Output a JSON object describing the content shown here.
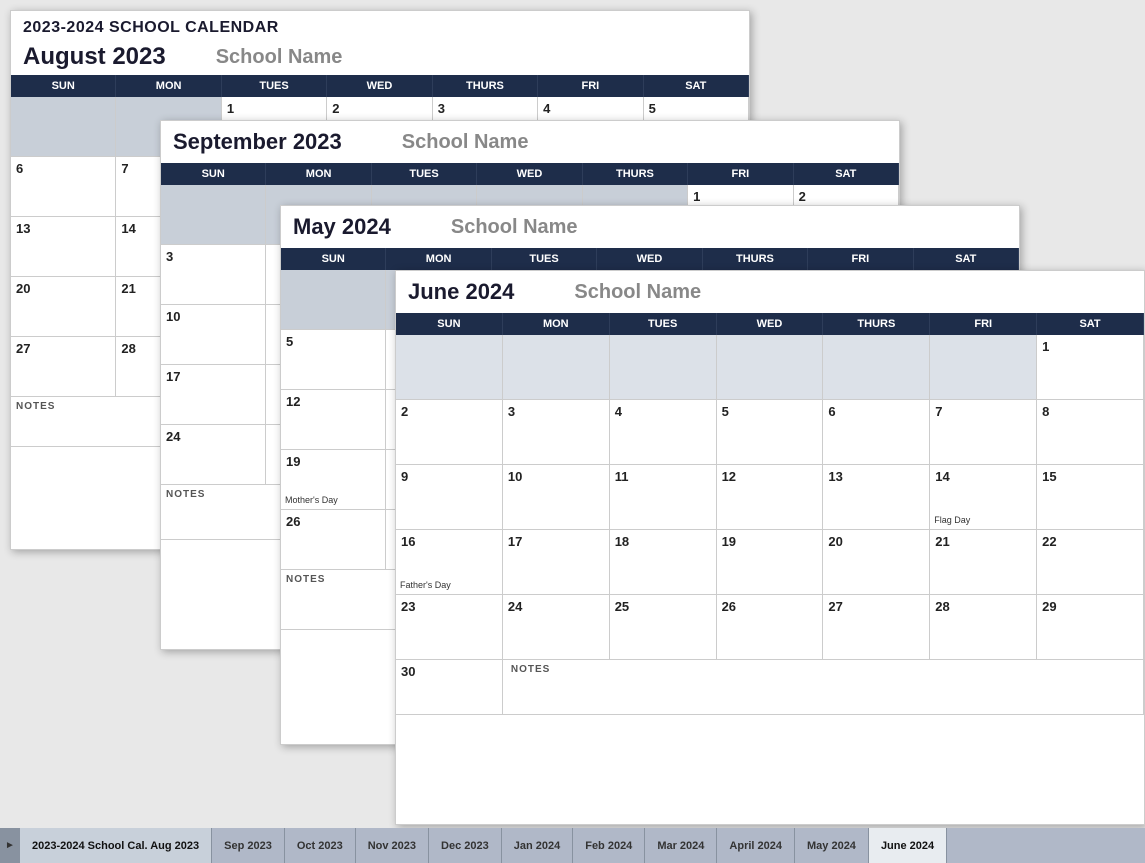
{
  "title": "2023-2024 SCHOOL CALENDAR",
  "school_name": "School Name",
  "colors": {
    "header_bg": "#1e2d4a",
    "gray_cell": "#c8cfd8",
    "light_cell": "#dce1e8"
  },
  "august": {
    "month_label": "August 2023",
    "school_name": "School Name",
    "days": [
      "SUN",
      "MON",
      "TUES",
      "WED",
      "THURS",
      "FRI",
      "SAT"
    ],
    "notes_label": "NOTES"
  },
  "september": {
    "month_label": "September 2023",
    "school_name": "School Name",
    "days": [
      "SUN",
      "MON",
      "TUES",
      "WED",
      "THURS",
      "FRI",
      "SAT"
    ],
    "notes_label": "NOTES"
  },
  "may2024": {
    "month_label": "May 2024",
    "school_name": "School Name",
    "days": [
      "SUN",
      "MON",
      "TUES",
      "WED",
      "THURS",
      "FRI",
      "SAT"
    ],
    "notes_label": "NOTES"
  },
  "june2024": {
    "month_label": "June 2024",
    "school_name": "School Name",
    "days": [
      "SUN",
      "MON",
      "TUES",
      "WED",
      "THURS",
      "FRI",
      "SAT"
    ],
    "notes_label": "NOTES",
    "events": {
      "14": "Flag Day",
      "16": "Father's Day"
    }
  },
  "tabs": [
    {
      "label": "2023-2024 School Cal. Aug 2023",
      "active": true
    },
    {
      "label": "Sep 2023"
    },
    {
      "label": "Oct 2023"
    },
    {
      "label": "Nov 2023"
    },
    {
      "label": "Dec 2023"
    },
    {
      "label": "Jan 2024"
    },
    {
      "label": "Feb 2024"
    },
    {
      "label": "Mar 2024"
    },
    {
      "label": "April 2024"
    },
    {
      "label": "May 2024"
    },
    {
      "label": "June 2024",
      "selected": true
    }
  ]
}
